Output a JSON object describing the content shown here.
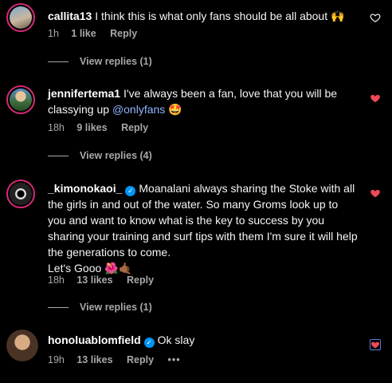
{
  "comments": [
    {
      "user": "callita13",
      "text": "I think this is what only fans should be all about",
      "emoji": "🙌",
      "time": "1h",
      "likes": "1 like",
      "reply": "Reply",
      "view_replies": "View replies (1)"
    },
    {
      "user": "jennifertema1",
      "text": "I've always been a fan, love that you will be classying up",
      "mention": "@onlyfans",
      "emoji": "🤩",
      "time": "18h",
      "likes": "9 likes",
      "reply": "Reply",
      "view_replies": "View replies (4)"
    },
    {
      "user": "_kimonokaoi_",
      "verified": true,
      "text": "Moanalani always sharing the Stoke with all the girls in and out of the water. So many Groms look up to you and want to know what is the key to success by you sharing your training and surf tips with them I'm sure it will help the generations to come.",
      "text2": "Let's Gooo",
      "emoji": "🌺🤙🏾",
      "time": "18h",
      "likes": "13 likes",
      "reply": "Reply",
      "view_replies": "View replies (1)"
    },
    {
      "user": "honoluablomfield",
      "verified": true,
      "text": "Ok slay",
      "time": "19h",
      "likes": "13 likes",
      "reply": "Reply",
      "more": "•••"
    }
  ],
  "colors": {
    "liked_heart": "#ed4956",
    "verified": "#0095f6",
    "mention": "#8fb4ff"
  }
}
